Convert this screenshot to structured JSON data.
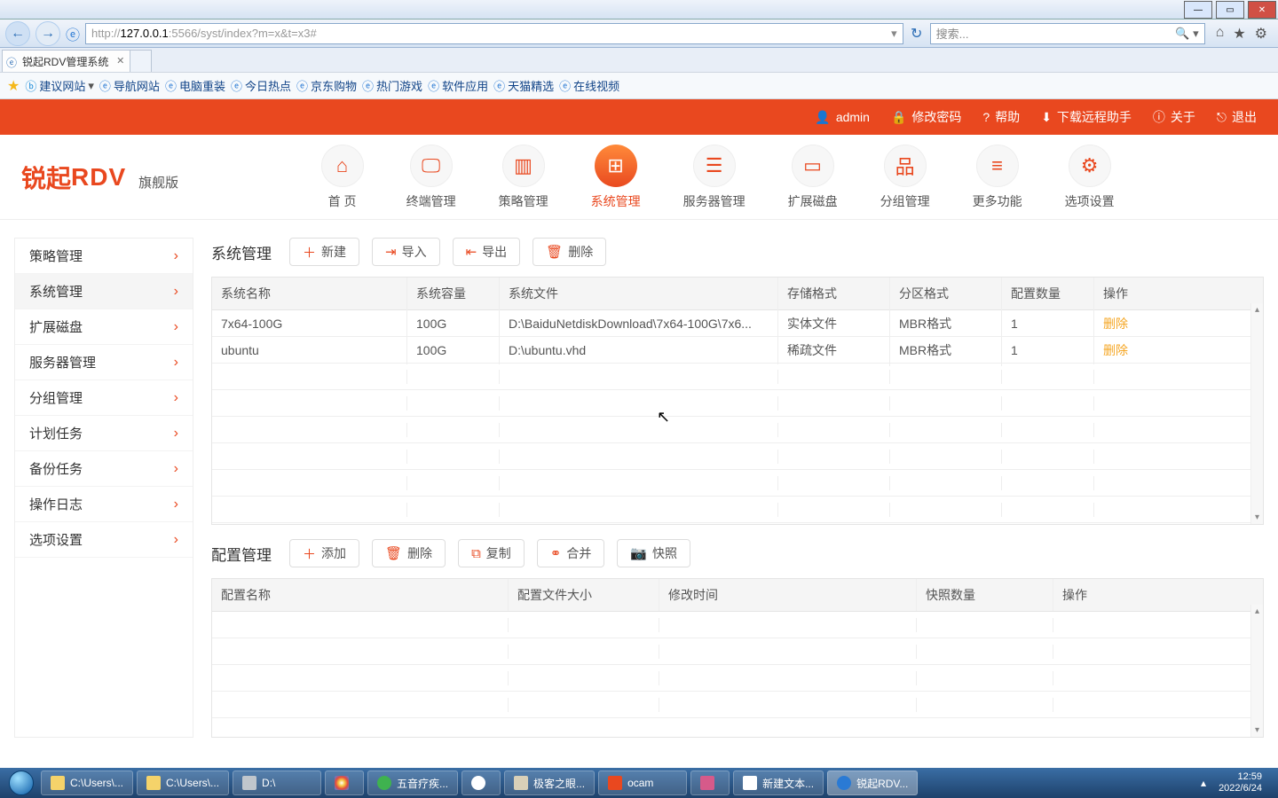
{
  "window": {
    "tab_title": "锐起RDV管理系统",
    "url_prefix": "http://",
    "url_host": "127.0.0.1",
    "url_rest": ":5566/syst/index?m=x&t=x3#",
    "search_placeholder": "搜索..."
  },
  "favorites": [
    "建议网站",
    "导航网站",
    "电脑重装",
    "今日热点",
    "京东购物",
    "热门游戏",
    "软件应用",
    "天猫精选",
    "在线视频"
  ],
  "topbar": {
    "user": "admin",
    "change_pw": "修改密码",
    "help": "帮助",
    "download": "下载远程助手",
    "about": "关于",
    "logout": "退出"
  },
  "brand": {
    "zh": "锐起",
    "en": "RDV",
    "edition": "旗舰版"
  },
  "nav": [
    {
      "label": "首 页"
    },
    {
      "label": "终端管理"
    },
    {
      "label": "策略管理"
    },
    {
      "label": "系统管理",
      "active": true
    },
    {
      "label": "服务器管理"
    },
    {
      "label": "扩展磁盘"
    },
    {
      "label": "分组管理"
    },
    {
      "label": "更多功能"
    },
    {
      "label": "选项设置"
    }
  ],
  "sidebar": [
    {
      "label": "策略管理"
    },
    {
      "label": "系统管理",
      "active": true
    },
    {
      "label": "扩展磁盘"
    },
    {
      "label": "服务器管理"
    },
    {
      "label": "分组管理"
    },
    {
      "label": "计划任务"
    },
    {
      "label": "备份任务"
    },
    {
      "label": "操作日志"
    },
    {
      "label": "选项设置"
    }
  ],
  "sys": {
    "title": "系统管理",
    "btn_new": "新建",
    "btn_import": "导入",
    "btn_export": "导出",
    "btn_delete": "删除",
    "cols": {
      "name": "系统名称",
      "cap": "系统容量",
      "file": "系统文件",
      "store": "存储格式",
      "fmt": "分区格式",
      "cfg": "配置数量",
      "act": "操作"
    },
    "rows": [
      {
        "name": "7x64-100G",
        "cap": "100G",
        "file": "D:\\BaiduNetdiskDownload\\7x64-100G\\7x6...",
        "store": "实体文件",
        "fmt": "MBR格式",
        "cfg": "1",
        "act": "删除"
      },
      {
        "name": "ubuntu",
        "cap": "100G",
        "file": "D:\\ubuntu.vhd",
        "store": "稀疏文件",
        "fmt": "MBR格式",
        "cfg": "1",
        "act": "删除"
      }
    ]
  },
  "cfg": {
    "title": "配置管理",
    "btn_add": "添加",
    "btn_del": "删除",
    "btn_copy": "复制",
    "btn_merge": "合并",
    "btn_snap": "快照",
    "cols": {
      "name": "配置名称",
      "size": "配置文件大小",
      "time": "修改时间",
      "snap": "快照数量",
      "act": "操作"
    }
  },
  "taskbar": {
    "items": [
      {
        "label": "C:\\Users\\..."
      },
      {
        "label": "C:\\Users\\..."
      },
      {
        "label": "D:\\"
      },
      {
        "label": ""
      },
      {
        "label": "五音疗疾..."
      },
      {
        "label": ""
      },
      {
        "label": "极客之眼..."
      },
      {
        "label": "ocam"
      },
      {
        "label": ""
      },
      {
        "label": "新建文本..."
      },
      {
        "label": "锐起RDV...",
        "active": true
      }
    ],
    "time": "12:59",
    "date": "2022/6/24"
  }
}
